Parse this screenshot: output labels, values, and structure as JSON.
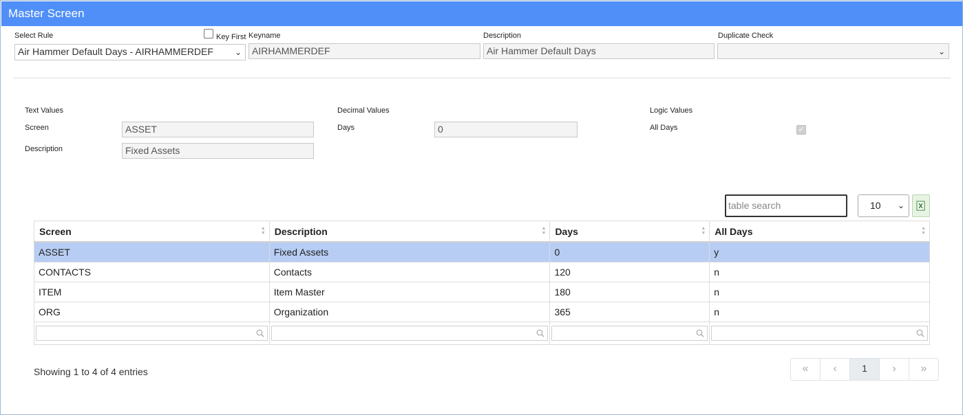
{
  "window": {
    "title": "Master Screen"
  },
  "header": {
    "select_rule_label": "Select Rule",
    "select_rule_value": "Air Hammer Default Days - AIRHAMMERDEF",
    "key_first_label": "Key First",
    "keyname_label": "Keyname",
    "keyname_value": "AIRHAMMERDEF",
    "description_label": "Description",
    "description_value": "Air Hammer Default Days",
    "duplicate_check_label": "Duplicate Check",
    "duplicate_check_value": ""
  },
  "sections": {
    "text_values_label": "Text Values",
    "screen_label": "Screen",
    "screen_value": "ASSET",
    "text_description_label": "Description",
    "text_description_value": "Fixed Assets",
    "decimal_values_label": "Decimal Values",
    "days_label": "Days",
    "days_value": "0",
    "logic_values_label": "Logic Values",
    "all_days_label": "All Days",
    "all_days_checked": true
  },
  "table_controls": {
    "search_placeholder": "table search",
    "page_size": "10"
  },
  "table": {
    "columns": [
      "Screen",
      "Description",
      "Days",
      "All Days"
    ],
    "rows": [
      [
        "ASSET",
        "Fixed Assets",
        "0",
        "y"
      ],
      [
        "CONTACTS",
        "Contacts",
        "120",
        "n"
      ],
      [
        "ITEM",
        "Item Master",
        "180",
        "n"
      ],
      [
        "ORG",
        "Organization",
        "365",
        "n"
      ]
    ],
    "selected_row": 0
  },
  "footer": {
    "info": "Showing 1 to 4 of 4 entries",
    "pager": {
      "first": "«",
      "prev": "‹",
      "current": "1",
      "next": "›",
      "last": "»"
    }
  },
  "colors": {
    "title_bar": "#4f8ff7",
    "selected_row": "#b7cdf3"
  },
  "icons": {
    "search": "search-icon",
    "excel": "excel-icon",
    "sort": "sort-icon",
    "dropdown": "chevron-down-icon"
  }
}
